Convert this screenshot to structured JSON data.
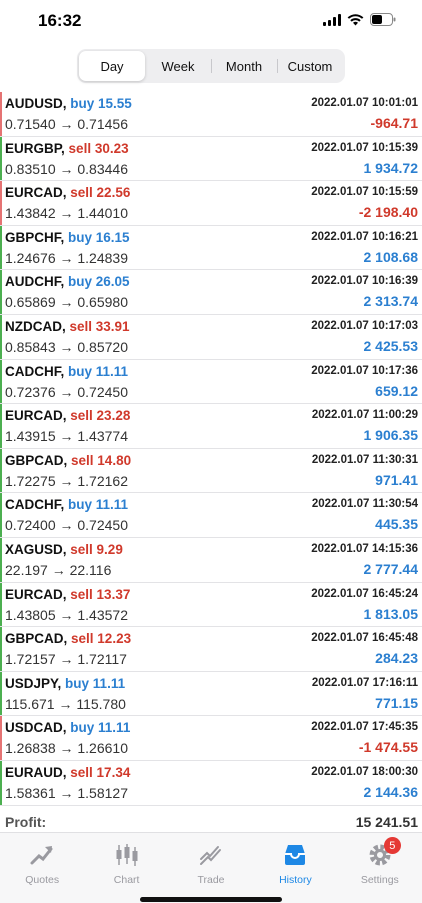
{
  "status": {
    "time": "16:32"
  },
  "segments": [
    {
      "label": "Day",
      "active": true
    },
    {
      "label": "Week",
      "active": false
    },
    {
      "label": "Month",
      "active": false
    },
    {
      "label": "Custom",
      "active": false
    }
  ],
  "trades": [
    {
      "symbol": "AUDUSD,",
      "side": "buy 15.55",
      "type": "buy",
      "time": "2022.01.07 10:01:01",
      "prices": "0.71540 → 0.71456",
      "profit": "-964.71",
      "result": "neg"
    },
    {
      "symbol": "EURGBP,",
      "side": "sell 30.23",
      "type": "sell",
      "time": "2022.01.07 10:15:39",
      "prices": "0.83510 → 0.83446",
      "profit": "1 934.72",
      "result": "pos"
    },
    {
      "symbol": "EURCAD,",
      "side": "sell 22.56",
      "type": "sell",
      "time": "2022.01.07 10:15:59",
      "prices": "1.43842 → 1.44010",
      "profit": "-2 198.40",
      "result": "neg"
    },
    {
      "symbol": "GBPCHF,",
      "side": "buy 16.15",
      "type": "buy",
      "time": "2022.01.07 10:16:21",
      "prices": "1.24676 → 1.24839",
      "profit": "2 108.68",
      "result": "pos"
    },
    {
      "symbol": "AUDCHF,",
      "side": "buy 26.05",
      "type": "buy",
      "time": "2022.01.07 10:16:39",
      "prices": "0.65869 → 0.65980",
      "profit": "2 313.74",
      "result": "pos"
    },
    {
      "symbol": "NZDCAD,",
      "side": "sell 33.91",
      "type": "sell",
      "time": "2022.01.07 10:17:03",
      "prices": "0.85843 → 0.85720",
      "profit": "2 425.53",
      "result": "pos"
    },
    {
      "symbol": "CADCHF,",
      "side": "buy 11.11",
      "type": "buy",
      "time": "2022.01.07 10:17:36",
      "prices": "0.72376 → 0.72450",
      "profit": "659.12",
      "result": "pos"
    },
    {
      "symbol": "EURCAD,",
      "side": "sell 23.28",
      "type": "sell",
      "time": "2022.01.07 11:00:29",
      "prices": "1.43915 → 1.43774",
      "profit": "1 906.35",
      "result": "pos"
    },
    {
      "symbol": "GBPCAD,",
      "side": "sell 14.80",
      "type": "sell",
      "time": "2022.01.07 11:30:31",
      "prices": "1.72275 → 1.72162",
      "profit": "971.41",
      "result": "pos"
    },
    {
      "symbol": "CADCHF,",
      "side": "buy 11.11",
      "type": "buy",
      "time": "2022.01.07 11:30:54",
      "prices": "0.72400 → 0.72450",
      "profit": "445.35",
      "result": "pos"
    },
    {
      "symbol": "XAGUSD,",
      "side": "sell 9.29",
      "type": "sell",
      "time": "2022.01.07 14:15:36",
      "prices": "22.197 → 22.116",
      "profit": "2 777.44",
      "result": "pos"
    },
    {
      "symbol": "EURCAD,",
      "side": "sell 13.37",
      "type": "sell",
      "time": "2022.01.07 16:45:24",
      "prices": "1.43805 → 1.43572",
      "profit": "1 813.05",
      "result": "pos"
    },
    {
      "symbol": "GBPCAD,",
      "side": "sell 12.23",
      "type": "sell",
      "time": "2022.01.07 16:45:48",
      "prices": "1.72157 → 1.72117",
      "profit": "284.23",
      "result": "pos"
    },
    {
      "symbol": "USDJPY,",
      "side": "buy 11.11",
      "type": "buy",
      "time": "2022.01.07 17:16:11",
      "prices": "115.671 → 115.780",
      "profit": "771.15",
      "result": "pos"
    },
    {
      "symbol": "USDCAD,",
      "side": "buy 11.11",
      "type": "buy",
      "time": "2022.01.07 17:45:35",
      "prices": "1.26838 → 1.26610",
      "profit": "-1 474.55",
      "result": "neg"
    },
    {
      "symbol": "EURAUD,",
      "side": "sell 17.34",
      "type": "sell",
      "time": "2022.01.07 18:00:30",
      "prices": "1.58361 → 1.58127",
      "profit": "2 144.36",
      "result": "pos"
    }
  ],
  "summary": {
    "label": "Profit:",
    "value": "15 241.51"
  },
  "tabs": [
    {
      "label": "Quotes",
      "icon": "quotes-icon"
    },
    {
      "label": "Chart",
      "icon": "chart-icon"
    },
    {
      "label": "Trade",
      "icon": "trade-icon"
    },
    {
      "label": "History",
      "icon": "history-icon",
      "active": true
    },
    {
      "label": "Settings",
      "icon": "settings-icon",
      "badge": "5"
    }
  ],
  "colors": {
    "buy": "#2b7fd0",
    "sell": "#d0392b",
    "active_tab": "#1e88e5",
    "badge": "#e53935",
    "bar_green": "#4caf50",
    "bar_red": "#e57373"
  }
}
